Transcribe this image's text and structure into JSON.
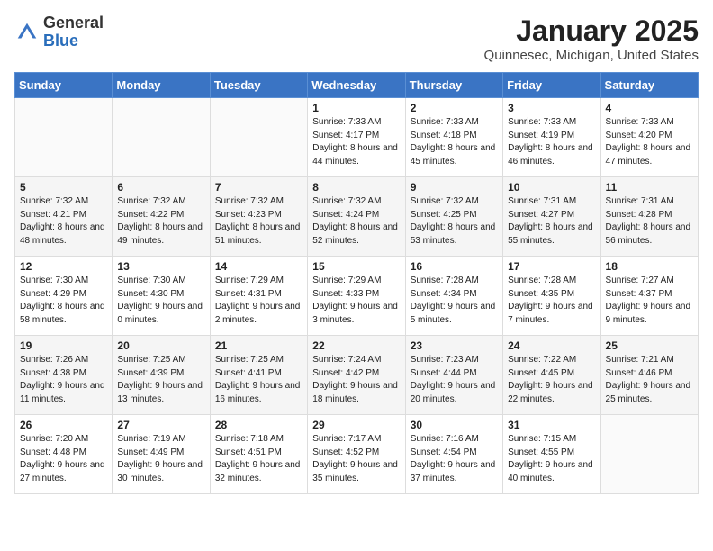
{
  "header": {
    "logo_general": "General",
    "logo_blue": "Blue",
    "month_title": "January 2025",
    "location": "Quinnesec, Michigan, United States"
  },
  "days_of_week": [
    "Sunday",
    "Monday",
    "Tuesday",
    "Wednesday",
    "Thursday",
    "Friday",
    "Saturday"
  ],
  "weeks": [
    [
      {
        "day": "",
        "sunrise": "",
        "sunset": "",
        "daylight": ""
      },
      {
        "day": "",
        "sunrise": "",
        "sunset": "",
        "daylight": ""
      },
      {
        "day": "",
        "sunrise": "",
        "sunset": "",
        "daylight": ""
      },
      {
        "day": "1",
        "sunrise": "Sunrise: 7:33 AM",
        "sunset": "Sunset: 4:17 PM",
        "daylight": "Daylight: 8 hours and 44 minutes."
      },
      {
        "day": "2",
        "sunrise": "Sunrise: 7:33 AM",
        "sunset": "Sunset: 4:18 PM",
        "daylight": "Daylight: 8 hours and 45 minutes."
      },
      {
        "day": "3",
        "sunrise": "Sunrise: 7:33 AM",
        "sunset": "Sunset: 4:19 PM",
        "daylight": "Daylight: 8 hours and 46 minutes."
      },
      {
        "day": "4",
        "sunrise": "Sunrise: 7:33 AM",
        "sunset": "Sunset: 4:20 PM",
        "daylight": "Daylight: 8 hours and 47 minutes."
      }
    ],
    [
      {
        "day": "5",
        "sunrise": "Sunrise: 7:32 AM",
        "sunset": "Sunset: 4:21 PM",
        "daylight": "Daylight: 8 hours and 48 minutes."
      },
      {
        "day": "6",
        "sunrise": "Sunrise: 7:32 AM",
        "sunset": "Sunset: 4:22 PM",
        "daylight": "Daylight: 8 hours and 49 minutes."
      },
      {
        "day": "7",
        "sunrise": "Sunrise: 7:32 AM",
        "sunset": "Sunset: 4:23 PM",
        "daylight": "Daylight: 8 hours and 51 minutes."
      },
      {
        "day": "8",
        "sunrise": "Sunrise: 7:32 AM",
        "sunset": "Sunset: 4:24 PM",
        "daylight": "Daylight: 8 hours and 52 minutes."
      },
      {
        "day": "9",
        "sunrise": "Sunrise: 7:32 AM",
        "sunset": "Sunset: 4:25 PM",
        "daylight": "Daylight: 8 hours and 53 minutes."
      },
      {
        "day": "10",
        "sunrise": "Sunrise: 7:31 AM",
        "sunset": "Sunset: 4:27 PM",
        "daylight": "Daylight: 8 hours and 55 minutes."
      },
      {
        "day": "11",
        "sunrise": "Sunrise: 7:31 AM",
        "sunset": "Sunset: 4:28 PM",
        "daylight": "Daylight: 8 hours and 56 minutes."
      }
    ],
    [
      {
        "day": "12",
        "sunrise": "Sunrise: 7:30 AM",
        "sunset": "Sunset: 4:29 PM",
        "daylight": "Daylight: 8 hours and 58 minutes."
      },
      {
        "day": "13",
        "sunrise": "Sunrise: 7:30 AM",
        "sunset": "Sunset: 4:30 PM",
        "daylight": "Daylight: 9 hours and 0 minutes."
      },
      {
        "day": "14",
        "sunrise": "Sunrise: 7:29 AM",
        "sunset": "Sunset: 4:31 PM",
        "daylight": "Daylight: 9 hours and 2 minutes."
      },
      {
        "day": "15",
        "sunrise": "Sunrise: 7:29 AM",
        "sunset": "Sunset: 4:33 PM",
        "daylight": "Daylight: 9 hours and 3 minutes."
      },
      {
        "day": "16",
        "sunrise": "Sunrise: 7:28 AM",
        "sunset": "Sunset: 4:34 PM",
        "daylight": "Daylight: 9 hours and 5 minutes."
      },
      {
        "day": "17",
        "sunrise": "Sunrise: 7:28 AM",
        "sunset": "Sunset: 4:35 PM",
        "daylight": "Daylight: 9 hours and 7 minutes."
      },
      {
        "day": "18",
        "sunrise": "Sunrise: 7:27 AM",
        "sunset": "Sunset: 4:37 PM",
        "daylight": "Daylight: 9 hours and 9 minutes."
      }
    ],
    [
      {
        "day": "19",
        "sunrise": "Sunrise: 7:26 AM",
        "sunset": "Sunset: 4:38 PM",
        "daylight": "Daylight: 9 hours and 11 minutes."
      },
      {
        "day": "20",
        "sunrise": "Sunrise: 7:25 AM",
        "sunset": "Sunset: 4:39 PM",
        "daylight": "Daylight: 9 hours and 13 minutes."
      },
      {
        "day": "21",
        "sunrise": "Sunrise: 7:25 AM",
        "sunset": "Sunset: 4:41 PM",
        "daylight": "Daylight: 9 hours and 16 minutes."
      },
      {
        "day": "22",
        "sunrise": "Sunrise: 7:24 AM",
        "sunset": "Sunset: 4:42 PM",
        "daylight": "Daylight: 9 hours and 18 minutes."
      },
      {
        "day": "23",
        "sunrise": "Sunrise: 7:23 AM",
        "sunset": "Sunset: 4:44 PM",
        "daylight": "Daylight: 9 hours and 20 minutes."
      },
      {
        "day": "24",
        "sunrise": "Sunrise: 7:22 AM",
        "sunset": "Sunset: 4:45 PM",
        "daylight": "Daylight: 9 hours and 22 minutes."
      },
      {
        "day": "25",
        "sunrise": "Sunrise: 7:21 AM",
        "sunset": "Sunset: 4:46 PM",
        "daylight": "Daylight: 9 hours and 25 minutes."
      }
    ],
    [
      {
        "day": "26",
        "sunrise": "Sunrise: 7:20 AM",
        "sunset": "Sunset: 4:48 PM",
        "daylight": "Daylight: 9 hours and 27 minutes."
      },
      {
        "day": "27",
        "sunrise": "Sunrise: 7:19 AM",
        "sunset": "Sunset: 4:49 PM",
        "daylight": "Daylight: 9 hours and 30 minutes."
      },
      {
        "day": "28",
        "sunrise": "Sunrise: 7:18 AM",
        "sunset": "Sunset: 4:51 PM",
        "daylight": "Daylight: 9 hours and 32 minutes."
      },
      {
        "day": "29",
        "sunrise": "Sunrise: 7:17 AM",
        "sunset": "Sunset: 4:52 PM",
        "daylight": "Daylight: 9 hours and 35 minutes."
      },
      {
        "day": "30",
        "sunrise": "Sunrise: 7:16 AM",
        "sunset": "Sunset: 4:54 PM",
        "daylight": "Daylight: 9 hours and 37 minutes."
      },
      {
        "day": "31",
        "sunrise": "Sunrise: 7:15 AM",
        "sunset": "Sunset: 4:55 PM",
        "daylight": "Daylight: 9 hours and 40 minutes."
      },
      {
        "day": "",
        "sunrise": "",
        "sunset": "",
        "daylight": ""
      }
    ]
  ]
}
